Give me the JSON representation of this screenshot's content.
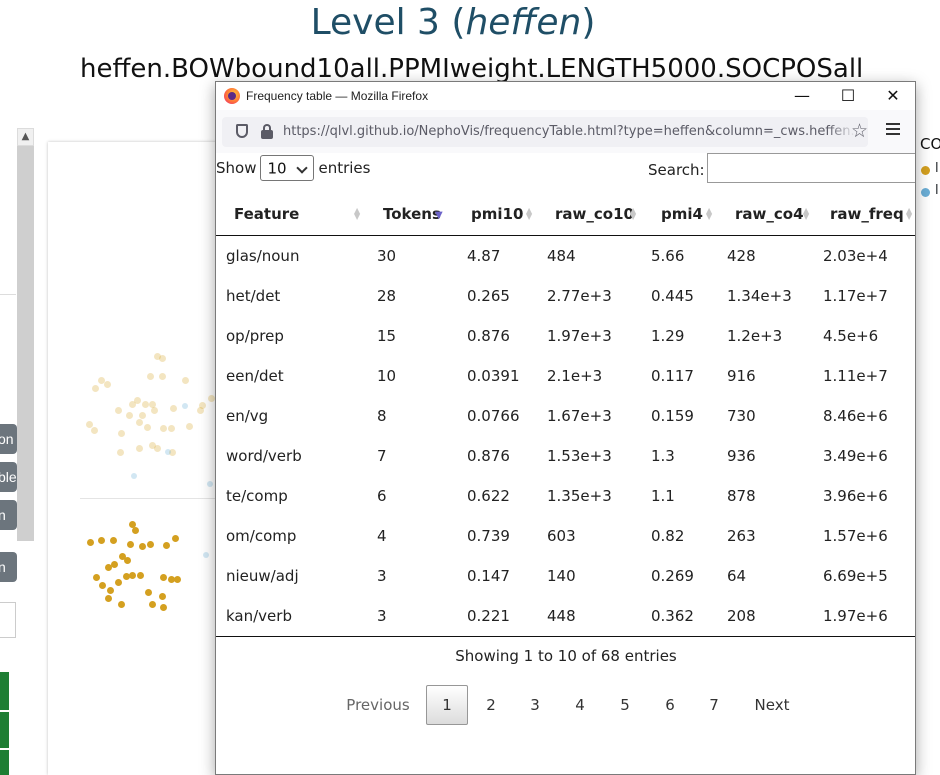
{
  "page": {
    "title_prefix": "Level 3 (",
    "title_lemma": "heffen",
    "title_suffix": ")",
    "model_name": "heffen.BOWbound10all.PPMIweight.LENGTH5000.SOCPOSall",
    "side_buttons": [
      "on",
      "ble",
      "n",
      "n"
    ],
    "legend_title": "CO",
    "legend_items": [
      {
        "label": "l",
        "color": "#d4a020"
      },
      {
        "label": "l",
        "color": "#6baed6"
      }
    ]
  },
  "browser": {
    "window_title": "Frequency table — Mozilla Firefox",
    "minimize": "—",
    "maximize": "☐",
    "close": "✕",
    "url": "https://qlvl.github.io/NephoVis/frequencyTable.html?type=heffen&column=_cws.heffen.BOW"
  },
  "table": {
    "show_label": "Show",
    "entries_label": "entries",
    "page_length": "10",
    "search_label": "Search:",
    "search_value": "",
    "columns": [
      "Feature",
      "Tokens",
      "pmi10",
      "raw_co10",
      "pmi4",
      "raw_co4",
      "raw_freq"
    ],
    "sorted_column": "Tokens",
    "rows": [
      [
        "glas/noun",
        "30",
        "4.87",
        "484",
        "5.66",
        "428",
        "2.03e+4"
      ],
      [
        "het/det",
        "28",
        "0.265",
        "2.77e+3",
        "0.445",
        "1.34e+3",
        "1.17e+7"
      ],
      [
        "op/prep",
        "15",
        "0.876",
        "1.97e+3",
        "1.29",
        "1.2e+3",
        "4.5e+6"
      ],
      [
        "een/det",
        "10",
        "0.0391",
        "2.1e+3",
        "0.117",
        "916",
        "1.11e+7"
      ],
      [
        "en/vg",
        "8",
        "0.0766",
        "1.67e+3",
        "0.159",
        "730",
        "8.46e+6"
      ],
      [
        "word/verb",
        "7",
        "0.876",
        "1.53e+3",
        "1.3",
        "936",
        "3.49e+6"
      ],
      [
        "te/comp",
        "6",
        "0.622",
        "1.35e+3",
        "1.1",
        "878",
        "3.96e+6"
      ],
      [
        "om/comp",
        "4",
        "0.739",
        "603",
        "0.82",
        "263",
        "1.57e+6"
      ],
      [
        "nieuw/adj",
        "3",
        "0.147",
        "140",
        "0.269",
        "64",
        "6.69e+5"
      ],
      [
        "kan/verb",
        "3",
        "0.221",
        "448",
        "0.362",
        "208",
        "1.97e+6"
      ]
    ],
    "info": "Showing 1 to 10 of 68 entries",
    "pagination": {
      "previous": "Previous",
      "pages": [
        "1",
        "2",
        "3",
        "4",
        "5",
        "6",
        "7"
      ],
      "current": "1",
      "next": "Next"
    }
  }
}
